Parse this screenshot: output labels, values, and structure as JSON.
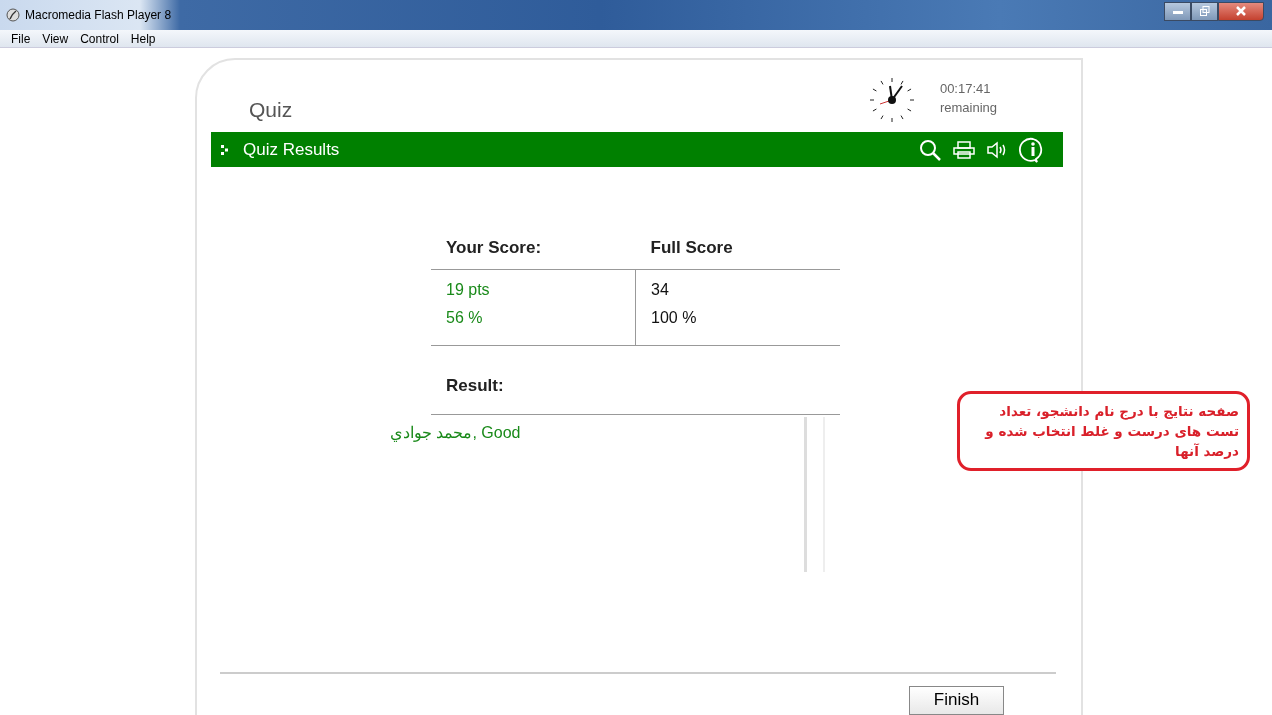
{
  "window": {
    "title": "Macromedia Flash Player 8"
  },
  "menu": [
    "File",
    "View",
    "Control",
    "Help"
  ],
  "quiz": {
    "title": "Quiz",
    "timer": "00:17:41",
    "timer_label": "remaining"
  },
  "section": {
    "title": "Quiz Results"
  },
  "score": {
    "headers": [
      "Your Score:",
      "Full Score"
    ],
    "rows": [
      {
        "yours": "19 pts",
        "full": "34"
      },
      {
        "yours": "56 %",
        "full": "100 %"
      }
    ]
  },
  "result": {
    "label": "Result:",
    "text": "محمد جوادي, Good"
  },
  "buttons": [
    "Finish"
  ],
  "annotation": "صفحه نتایج با درج نام دانشجو، تعداد\nتست های درست و غلط انتخاب شده و\nدرصد آنها"
}
